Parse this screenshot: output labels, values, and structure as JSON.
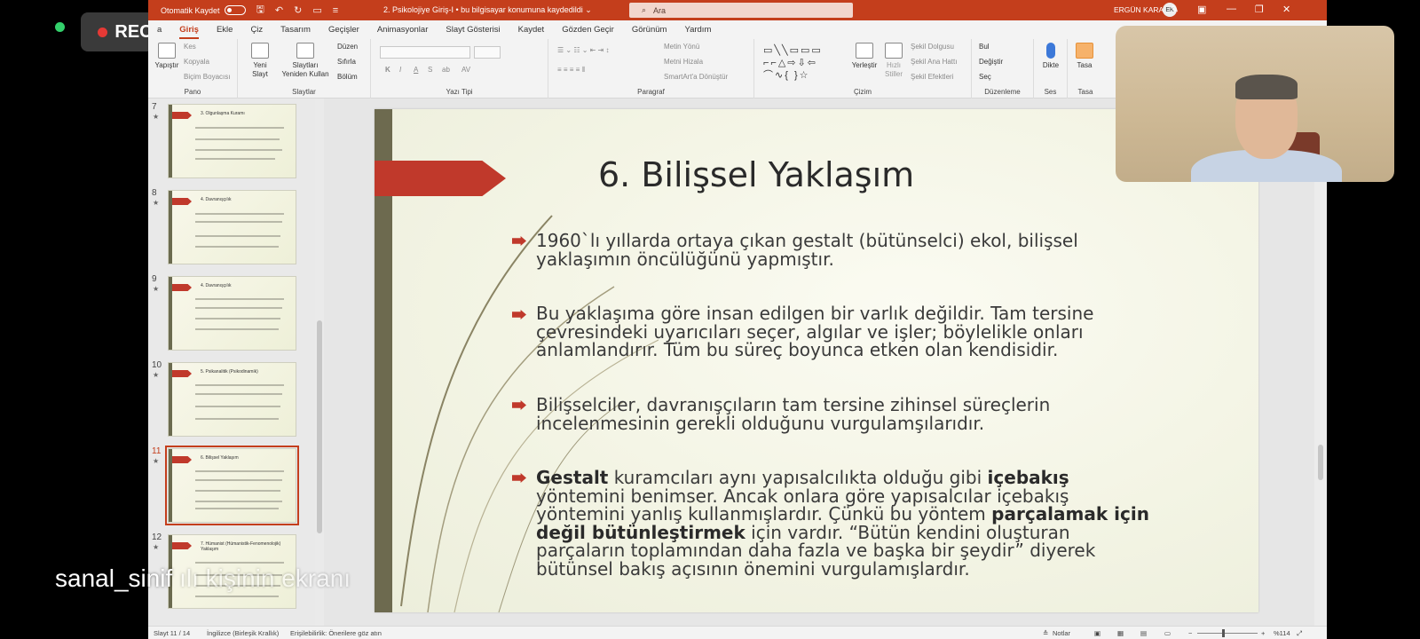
{
  "overlay": {
    "rec_label": "REC",
    "caption": "sanal_sinif",
    "caption_faded": "ılı kişinin ekranı"
  },
  "titlebar": {
    "autosave_label": "Otomatik Kaydet",
    "doc_title": "2. Psikolojiye Giriş-I  •  bu bilgisayar konumuna kaydedildi ⌄",
    "search_placeholder": "Ara",
    "user_name": "ERGÜN KARA",
    "user_initials": "EK"
  },
  "menu": {
    "tabs": [
      "a",
      "Giriş",
      "Ekle",
      "Çiz",
      "Tasarım",
      "Geçişler",
      "Animasyonlar",
      "Slayt Gösterisi",
      "Kaydet",
      "Gözden Geçir",
      "Görünüm",
      "Yardım"
    ]
  },
  "ribbon": {
    "pano": {
      "label": "Pano",
      "paste": "Yapıştır",
      "cut": "Kes",
      "copy": "Kopyala",
      "format_painter": "Biçim Boyacısı"
    },
    "slaytlar": {
      "label": "Slaytlar",
      "new_slide": "Yeni Slayt",
      "reuse": "Slaytları Yeniden Kullan",
      "layout": "Düzen",
      "reset": "Sıfırla",
      "section": "Bölüm"
    },
    "yazi_tipi": {
      "label": "Yazı Tipi",
      "bold": "K",
      "italic": "I",
      "underline": "A",
      "strike": "S",
      "shadow": "ab",
      "spacing": "AV"
    },
    "paragraf": {
      "label": "Paragraf",
      "text_dir": "Metin Yönü",
      "align_text": "Metni Hizala",
      "smartart": "SmartArt'a Dönüştür"
    },
    "cizim": {
      "label": "Çizim",
      "arrange": "Yerleştir",
      "quick_styles": "Hızlı Stiller",
      "fill": "Şekil Dolgusu",
      "outline": "Şekil Ana Hattı",
      "effects": "Şekil Efektleri"
    },
    "duzenleme": {
      "label": "Düzenleme",
      "find": "Bul",
      "replace": "Değiştir",
      "select": "Seç"
    },
    "ses": {
      "label": "Ses",
      "dictate": "Dikte"
    },
    "tasarim": {
      "label": "Tasa",
      "designer": "Tasa"
    }
  },
  "thumbnails": [
    {
      "num": "7",
      "title": "3. Olgunlaşma Kuramı"
    },
    {
      "num": "8",
      "title": "4. Davranışçılık"
    },
    {
      "num": "9",
      "title": "4. Davranışçılık"
    },
    {
      "num": "10",
      "title": "5. Psikanalitik (Psikodinamik)"
    },
    {
      "num": "11",
      "title": "6. Bilişsel Yaklaşım"
    },
    {
      "num": "12",
      "title": "7. Hümanist (Hümanistik-Fenomenolojik) Yaklaşım"
    }
  ],
  "slide": {
    "title": "6. Bilişsel Yaklaşım",
    "b1": "1960`lı yıllarda ortaya çıkan gestalt (bütünselci) ekol, bilişsel yaklaşımın öncülüğünü yapmıştır.",
    "b2": " Bu yaklaşıma göre insan edilgen bir varlık değildir. Tam tersine çevresindeki uyarıcıları seçer, algılar ve işler; böylelikle onları anlamlandırır. Tüm bu süreç boyunca etken olan kendisidir.",
    "b3": "Bilişselciler, davranışçıların tam tersine zihinsel süreçlerin incelenmesinin gerekli olduğunu vurgulamşılarıdır.",
    "b4_p1": "Gestalt",
    "b4_p2": " kuramcıları aynı yapısalcılıkta olduğu gibi ",
    "b4_p3": "içebakış",
    "b4_p4": " yöntemini benimser. Ancak onlara göre yapısalcılar içebakış yöntemini yanlış kullanmışlardır. Çünkü bu yöntem ",
    "b4_p5": "parçalamak için değil bütünleştirmek",
    "b4_p6": " için vardır. “Bütün kendini oluşturan parçaların toplamından daha fazla ve başka bir şeydir” diyerek bütünsel bakış açısının önemini vurgulamışlardır."
  },
  "status": {
    "slide_pos": "Slayt 11 / 14",
    "language": "İngilizce (Birleşik Krallık)",
    "accessibility": "Erişilebilirlik: Önerilere göz atın",
    "notes": "Notlar",
    "zoom": "%114"
  },
  "colors": {
    "accent": "#c43e1c",
    "slide_red": "#c0392b"
  }
}
